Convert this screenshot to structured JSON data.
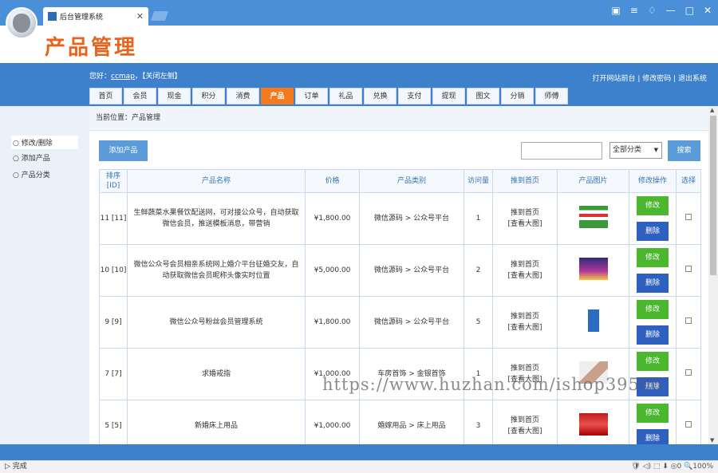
{
  "browser": {
    "tab_title": "后台管理系统",
    "status": "完成",
    "zoom": "100%",
    "zoom_count": "0"
  },
  "header": {
    "title": "产品管理"
  },
  "top": {
    "greeting_prefix": "您好：",
    "username": "ccmap",
    "close_left": "【关闭左侧】",
    "links": "打开网站前台 | 修改密码 | 退出系统"
  },
  "nav": [
    {
      "label": "首页"
    },
    {
      "label": "会员"
    },
    {
      "label": "现金"
    },
    {
      "label": "积分"
    },
    {
      "label": "消费"
    },
    {
      "label": "产品",
      "active": true
    },
    {
      "label": "订单"
    },
    {
      "label": "礼品"
    },
    {
      "label": "兑换"
    },
    {
      "label": "支付"
    },
    {
      "label": "提现"
    },
    {
      "label": "图文"
    },
    {
      "label": "分销"
    },
    {
      "label": "师傅"
    }
  ],
  "sidebar": {
    "items": [
      {
        "label": "○ 修改/删除",
        "active": true
      },
      {
        "label": "○ 添加产品"
      },
      {
        "label": "○ 产品分类"
      }
    ]
  },
  "breadcrumb": "当前位置：产品管理",
  "toolbar": {
    "add_label": "添加产品",
    "search_placeholder": "",
    "category_selected": "全部分类",
    "search_label": "搜索"
  },
  "table": {
    "headers": [
      "排序\n[ID]",
      "产品名称",
      "价格",
      "产品类别",
      "访问量",
      "推到首页",
      "产品图片",
      "修改操作",
      "选择"
    ],
    "rows": [
      {
        "id": "11 [11]",
        "name": "生鲜蔬菜水果餐饮配送网，可对接公众号，自动获取微信会员，推送模板消息，带营销",
        "price": "¥1,800.00",
        "category": "微信源码 > 公众号平台",
        "views": "1",
        "push": "推到首页",
        "view_large": "[查看大图]",
        "edit": "修改",
        "delete": "删除"
      },
      {
        "id": "10 [10]",
        "name": "微信公众号会员相亲系统网上婚介平台征婚交友，自动获取微信会员昵称头像实时位置",
        "price": "¥5,000.00",
        "category": "微信源码 > 公众号平台",
        "views": "2",
        "push": "推到首页",
        "view_large": "[查看大图]",
        "edit": "修改",
        "delete": "删除"
      },
      {
        "id": "9 [9]",
        "name": "微信公众号粉丝会员管理系统",
        "price": "¥1,800.00",
        "category": "微信源码 > 公众号平台",
        "views": "5",
        "push": "推到首页",
        "view_large": "[查看大图]",
        "edit": "修改",
        "delete": "删除"
      },
      {
        "id": "7 [7]",
        "name": "求婚戒指",
        "price": "¥1,000.00",
        "category": "车房首饰 > 金银首饰",
        "views": "1",
        "push": "推到首页",
        "view_large": "[查看大图]",
        "edit": "修改",
        "delete": "删除"
      },
      {
        "id": "5 [5]",
        "name": "新婚床上用品",
        "price": "¥1,000.00",
        "category": "婚嫁用品 > 床上用品",
        "views": "3",
        "push": "推到首页",
        "view_large": "[查看大图]",
        "edit": "修改",
        "delete": "删除"
      }
    ]
  },
  "watermark": "https://www.huzhan.com/ishop39500",
  "colors": {
    "accent": "#3d80cc",
    "brand_title": "#e8641c",
    "active_tab": "#f47a20",
    "edit": "#4bb72e",
    "delete": "#2e60bf"
  }
}
